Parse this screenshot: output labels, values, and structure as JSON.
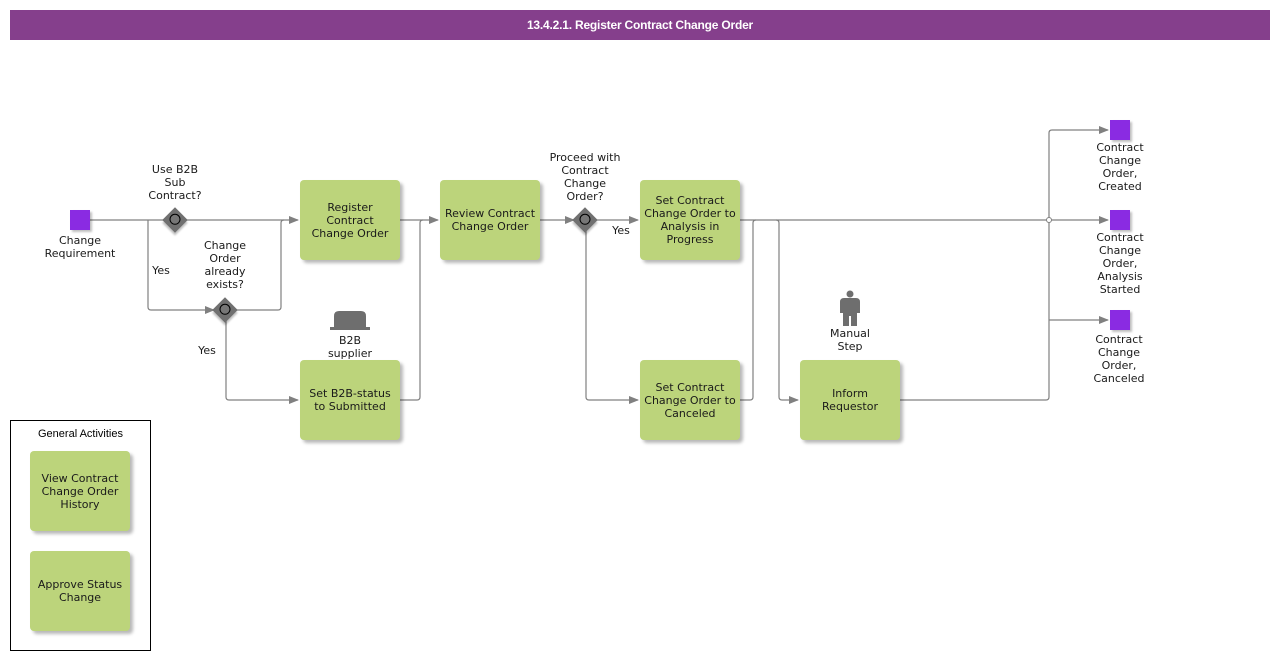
{
  "header": {
    "title": "13.4.2.1. Register Contract Change Order"
  },
  "colors": {
    "title_bar": "#853f8c",
    "task_fill": "#bcd47b",
    "event_fill": "#8a2be2",
    "gateway_fill": "#707070",
    "connector": "#808080"
  },
  "start_event": {
    "label": "Change\nRequirement"
  },
  "gateways": {
    "use_b2b": {
      "label": "Use B2B\nSub\nContract?",
      "yes_label": "Yes"
    },
    "order_exists": {
      "label": "Change\nOrder\nalready\nexists?",
      "yes_label": "Yes"
    },
    "proceed": {
      "label": "Proceed with\nContract\nChange\nOrder?",
      "yes_label": "Yes"
    }
  },
  "tasks": {
    "register": "Register Contract Change Order",
    "review": "Review Contract Change Order",
    "set_b2b_status": "Set B2B-status to Submitted",
    "set_analysis": "Set Contract Change Order to Analysis in Progress",
    "set_canceled": "Set Contract Change Order to Canceled",
    "inform_requestor": "Inform Requestor"
  },
  "annotations": {
    "b2b_supplier": {
      "icon": "system-icon",
      "label": "B2B\nsupplier"
    },
    "manual_step": {
      "icon": "person-icon",
      "label": "Manual\nStep"
    }
  },
  "end_events": {
    "created": "Contract\nChange\nOrder,\nCreated",
    "analysis_started": "Contract\nChange\nOrder,\nAnalysis\nStarted",
    "canceled": "Contract\nChange\nOrder,\nCanceled"
  },
  "general_activities": {
    "title": "General Activities",
    "items": [
      "View Contract Change Order History",
      "Approve Status Change"
    ]
  }
}
